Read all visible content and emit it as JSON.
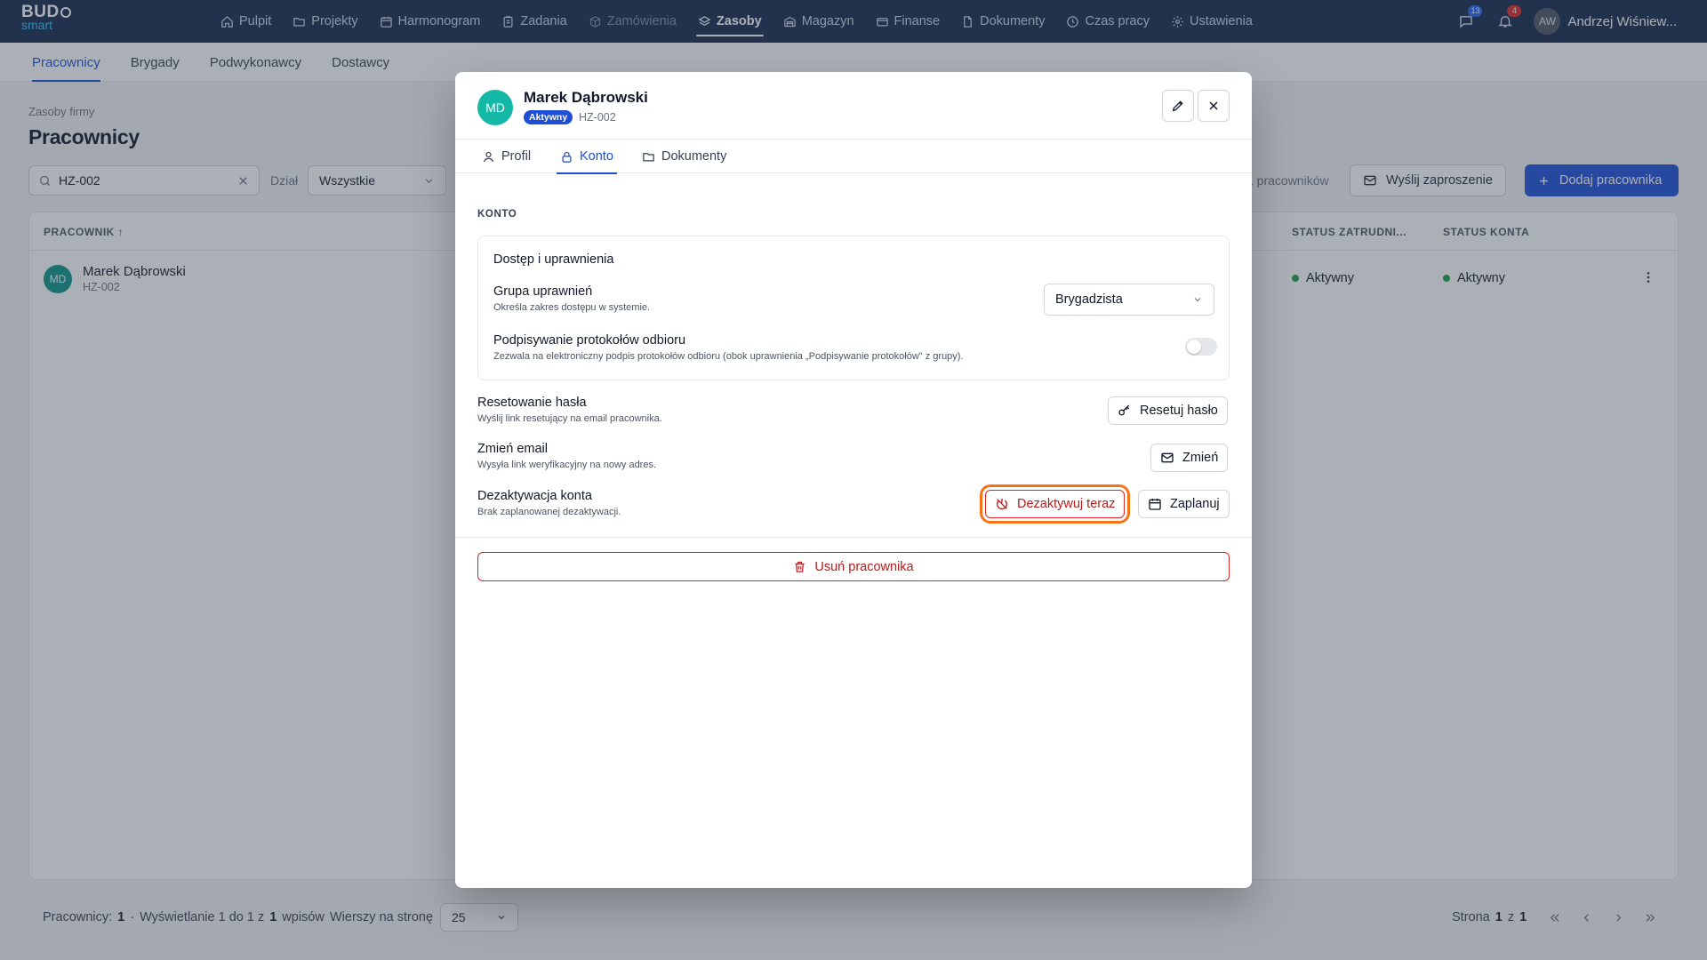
{
  "app": {
    "logo_top": "BUD",
    "logo_bottom": "smart"
  },
  "nav": [
    {
      "label": "Pulpit",
      "icon": "home-icon"
    },
    {
      "label": "Projekty",
      "icon": "folder-icon"
    },
    {
      "label": "Harmonogram",
      "icon": "calendar-icon"
    },
    {
      "label": "Zadania",
      "icon": "clipboard-icon"
    },
    {
      "label": "Zamówienia",
      "icon": "box-icon"
    },
    {
      "label": "Zasoby",
      "icon": "layers-icon"
    },
    {
      "label": "Magazyn",
      "icon": "warehouse-icon"
    },
    {
      "label": "Finanse",
      "icon": "card-icon"
    },
    {
      "label": "Dokumenty",
      "icon": "document-icon"
    },
    {
      "label": "Czas pracy",
      "icon": "clock-icon"
    },
    {
      "label": "Ustawienia",
      "icon": "gear-icon"
    }
  ],
  "topbar": {
    "messages_count": "13",
    "notifications_count": "4",
    "user_initials": "AW",
    "user_name": "Andrzej Wiśniew..."
  },
  "subnav": [
    "Pracownicy",
    "Brygady",
    "Podwykonawcy",
    "Dostawcy"
  ],
  "page": {
    "breadcrumb": "Zasoby firmy",
    "title": "Pracownicy"
  },
  "filters": {
    "search_value": "HZ-002",
    "dept_label": "Dział",
    "dept_value": "Wszystkie",
    "count_text": "1 pracowników"
  },
  "actions": {
    "invite": "Wyślij zaproszenie",
    "add": "Dodaj pracownika"
  },
  "table": {
    "headers": {
      "employee": "PRACOWNIK ↑",
      "employment_status": "STATUS ZATRUDNI...",
      "account_status": "STATUS KONTA"
    },
    "rows": [
      {
        "initials": "MD",
        "name": "Marek Dąbrowski",
        "id": "HZ-002",
        "employment_status": "Aktywny",
        "account_status": "Aktywny"
      }
    ]
  },
  "footer": {
    "employees_label": "Pracownicy:",
    "employees_count": "1",
    "sep": "·",
    "showing_pre": "Wyświetlanie 1 do 1 z",
    "showing_total": "1",
    "showing_post": "wpisów",
    "per_page_label": "Wierszy na stronę",
    "per_page_value": "25",
    "page_label": "Strona",
    "page_current": "1",
    "page_of": "z",
    "page_total": "1"
  },
  "modal": {
    "initials": "MD",
    "name": "Marek Dąbrowski",
    "badge": "Aktywny",
    "id": "HZ-002",
    "tabs": [
      "Profil",
      "Konto",
      "Dokumenty"
    ],
    "section": "KONTO",
    "card_title": "Dostęp i uprawnienia",
    "group": {
      "title": "Grupa uprawnień",
      "desc": "Określa zakres dostępu w systemie.",
      "value": "Brygadzista"
    },
    "signing": {
      "title": "Podpisywanie protokołów odbioru",
      "desc": "Zezwala na elektroniczny podpis protokołów odbioru (obok uprawnienia „Podpisywanie protokołów\" z grupy).",
      "enabled": false
    },
    "reset": {
      "title": "Resetowanie hasła",
      "desc": "Wyślij link resetujący na email pracownika.",
      "button": "Resetuj hasło"
    },
    "email": {
      "title": "Zmień email",
      "desc": "Wysyła link weryfikacyjny na nowy adres.",
      "button": "Zmień"
    },
    "deactivate": {
      "title": "Dezaktywacja konta",
      "desc": "Brak zaplanowanej dezaktywacji.",
      "button_now": "Dezaktywuj teraz",
      "button_schedule": "Zaplanuj"
    },
    "delete_button": "Usuń pracownika"
  },
  "colors": {
    "topbar": "#14284b",
    "primary": "#1d4ed8",
    "danger": "#dc2626",
    "focus_ring": "#f97316",
    "success": "#16a34a",
    "avatar": "#14b8a6"
  }
}
